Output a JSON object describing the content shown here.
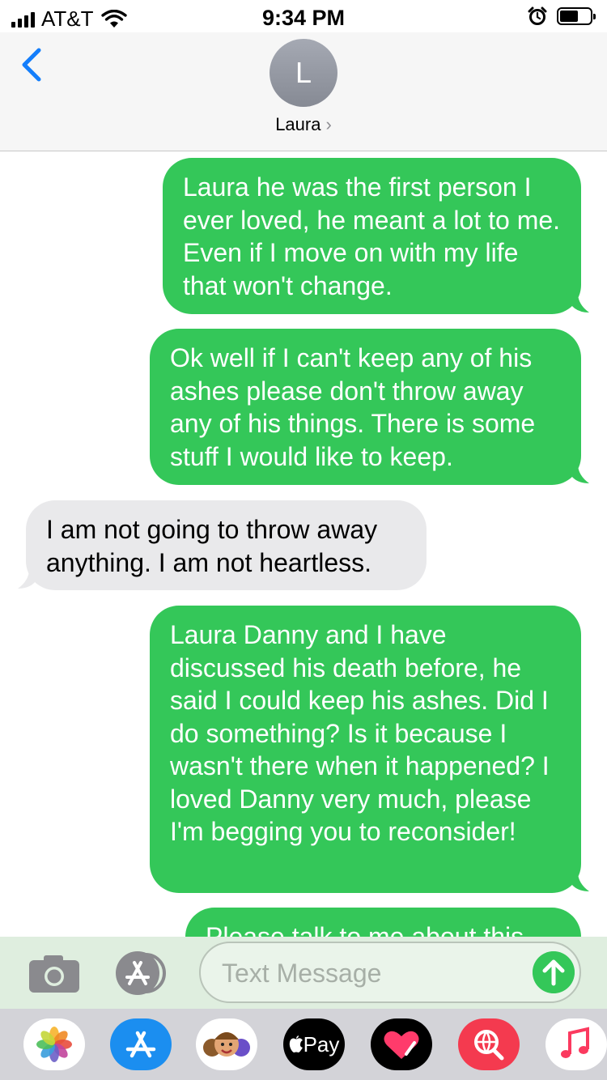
{
  "status_bar": {
    "carrier": "AT&T",
    "time": "9:34 PM",
    "signal_bars": 4,
    "battery_level": 0.6,
    "icons": [
      "signal-icon",
      "wifi-icon",
      "alarm-icon",
      "battery-icon"
    ]
  },
  "header": {
    "avatar_initial": "L",
    "contact_name": "Laura",
    "contact_chevron": "›",
    "back_icon": "chevron-left-icon"
  },
  "messages": [
    {
      "direction": "sent",
      "text": "Laura he was the first person I ever loved, he meant a lot to me. Even if I move on with my life that won't change."
    },
    {
      "direction": "sent",
      "text": "Ok well if I can't keep any of his ashes please don't throw away any of his things. There is some stuff I would like to keep."
    },
    {
      "direction": "received",
      "text": "I am not going to throw away anything. I am not heartless."
    },
    {
      "direction": "sent",
      "text": "Laura Danny and I have discussed his death before, he said I could keep his ashes. Did I do something? Is it because I wasn't there when it happened? I loved Danny very much, please I'm begging you to reconsider!"
    },
    {
      "direction": "sent",
      "text": "Please talk to me about this."
    }
  ],
  "input_bar": {
    "placeholder": "Text Message",
    "value": "",
    "icons": [
      "camera-icon",
      "app-store-icon",
      "send-arrow-icon"
    ]
  },
  "app_drawer": {
    "apple_pay_label": "Pay",
    "apps": [
      "photos-icon",
      "app-store-icon",
      "memoji-icon",
      "apple-pay-icon",
      "digital-touch-icon",
      "web-search-icon",
      "music-icon"
    ]
  },
  "colors": {
    "sent_bubble": "#34c759",
    "received_bubble": "#e9e9eb",
    "accent_blue": "#147efb",
    "input_bar_bg": "#dfeedf",
    "drawer_bg": "#d3d3d8"
  }
}
